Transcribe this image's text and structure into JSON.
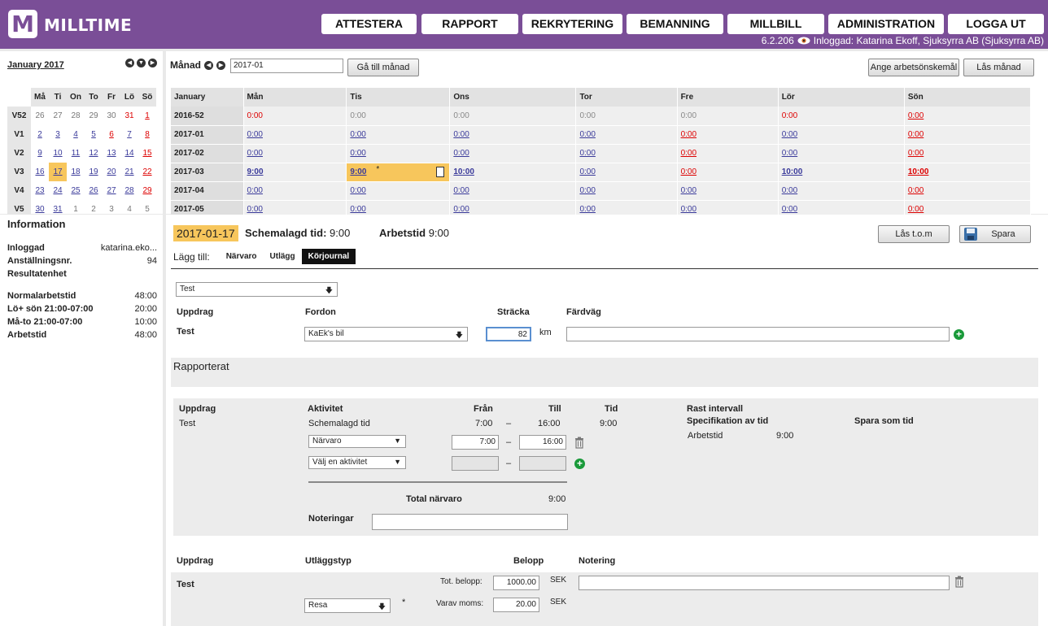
{
  "brand": {
    "logo_letter": "M",
    "name": "MILLTIME"
  },
  "nav": [
    "ATTESTERA",
    "RAPPORT",
    "REKRYTERING",
    "BEMANNING",
    "MILLBILL",
    "ADMINISTRATION",
    "LOGGA UT"
  ],
  "version": "6.2.206",
  "logged_in_text": "Inloggad: Katarina Ekoff, Sjuksyrra AB (Sjuksyrra AB)",
  "calendar": {
    "title": "January 2017",
    "headers": [
      "Må",
      "Ti",
      "On",
      "To",
      "Fr",
      "Lö",
      "Sö"
    ],
    "weeks": [
      {
        "wk": "V52",
        "days": [
          "26",
          "27",
          "28",
          "29",
          "30",
          "31",
          "1"
        ]
      },
      {
        "wk": "V1",
        "days": [
          "2",
          "3",
          "4",
          "5",
          "6",
          "7",
          "8"
        ]
      },
      {
        "wk": "V2",
        "days": [
          "9",
          "10",
          "11",
          "12",
          "13",
          "14",
          "15"
        ]
      },
      {
        "wk": "V3",
        "days": [
          "16",
          "17",
          "18",
          "19",
          "20",
          "21",
          "22"
        ]
      },
      {
        "wk": "V4",
        "days": [
          "23",
          "24",
          "25",
          "26",
          "27",
          "28",
          "29"
        ]
      },
      {
        "wk": "V5",
        "days": [
          "30",
          "31",
          "1",
          "2",
          "3",
          "4",
          "5"
        ]
      }
    ]
  },
  "info": {
    "title": "Information",
    "rows1": [
      {
        "label": "Inloggad",
        "value": "katarina.eko..."
      },
      {
        "label": "Anställningsnr.",
        "value": "94"
      },
      {
        "label": "Resultatenhet",
        "value": ""
      }
    ],
    "rows2": [
      {
        "label": "Normalarbetstid",
        "value": "48:00"
      },
      {
        "label": "Lö+ sön 21:00-07:00",
        "value": "20:00"
      },
      {
        "label": "Må-to 21:00-07:00",
        "value": "10:00"
      },
      {
        "label": "Arbetstid",
        "value": "48:00"
      }
    ]
  },
  "month": {
    "label": "Månad",
    "input_value": "2017-01",
    "goto_button": "Gå till månad",
    "wish_button": "Ange arbetsönskemål",
    "lock_button": "Lås månad",
    "columns": [
      "January",
      "Mån",
      "Tis",
      "Ons",
      "Tor",
      "Fre",
      "Lör",
      "Sön"
    ],
    "rows": [
      {
        "wk": "2016-52",
        "vals": [
          "0:00",
          "0:00",
          "0:00",
          "0:00",
          "0:00",
          "0:00",
          "0:00"
        ]
      },
      {
        "wk": "2017-01",
        "vals": [
          "0:00",
          "0:00",
          "0:00",
          "0:00",
          "0:00",
          "0:00",
          "0:00"
        ]
      },
      {
        "wk": "2017-02",
        "vals": [
          "0:00",
          "0:00",
          "0:00",
          "0:00",
          "0:00",
          "0:00",
          "0:00"
        ]
      },
      {
        "wk": "2017-03",
        "vals": [
          "9:00",
          "9:00",
          "10:00",
          "0:00",
          "0:00",
          "10:00",
          "10:00"
        ]
      },
      {
        "wk": "2017-04",
        "vals": [
          "0:00",
          "0:00",
          "0:00",
          "0:00",
          "0:00",
          "0:00",
          "0:00"
        ]
      },
      {
        "wk": "2017-05",
        "vals": [
          "0:00",
          "0:00",
          "0:00",
          "0:00",
          "0:00",
          "0:00",
          "0:00"
        ]
      }
    ],
    "star": "*"
  },
  "day": {
    "date": "2017-01-17",
    "sched_label": "Schemalagd tid:",
    "sched_value": "9:00",
    "work_label": "Arbetstid",
    "work_value": "9:00",
    "lock_btn": "Lås t.o.m",
    "save_btn": "Spara",
    "add_label": "Lägg till:",
    "tabs": [
      "Närvaro",
      "Utlägg",
      "Körjournal"
    ]
  },
  "korjournal": {
    "assignment_select": "Test",
    "headers": [
      "Uppdrag",
      "Fordon",
      "Sträcka",
      "Färdväg"
    ],
    "uppdrag": "Test",
    "fordon": "KaEk's bil",
    "stracka": "82",
    "unit": "km",
    "fardvag": ""
  },
  "rapporterat": {
    "title": "Rapporterat"
  },
  "narvaro": {
    "headers": [
      "Uppdrag",
      "Aktivitet",
      "Från",
      "Till",
      "Tid"
    ],
    "uppdrag": "Test",
    "sched_row": {
      "label": "Schemalagd tid",
      "from": "7:00",
      "to": "16:00",
      "tid": "9:00"
    },
    "row1": {
      "activity": "Närvaro",
      "from": "7:00",
      "to": "16:00"
    },
    "row2": {
      "activity": "Välj en aktivitet"
    },
    "dash": "–",
    "total_label": "Total närvaro",
    "total_value": "9:00",
    "notes_label": "Noteringar",
    "rast": "Rast intervall",
    "spec": "Specifikation av tid",
    "spara_som": "Spara som tid",
    "spec_row": {
      "label": "Arbetstid",
      "value": "9:00"
    }
  },
  "utlagg": {
    "headers": [
      "Uppdrag",
      "Utläggstyp",
      "Belopp",
      "Notering"
    ],
    "uppdrag": "Test",
    "tot_label": "Tot. belopp:",
    "tot_value": "1000.00",
    "moms_label": "Varav moms:",
    "moms_value": "20.00",
    "currency": "SEK",
    "type": "Resa",
    "star": "*"
  }
}
